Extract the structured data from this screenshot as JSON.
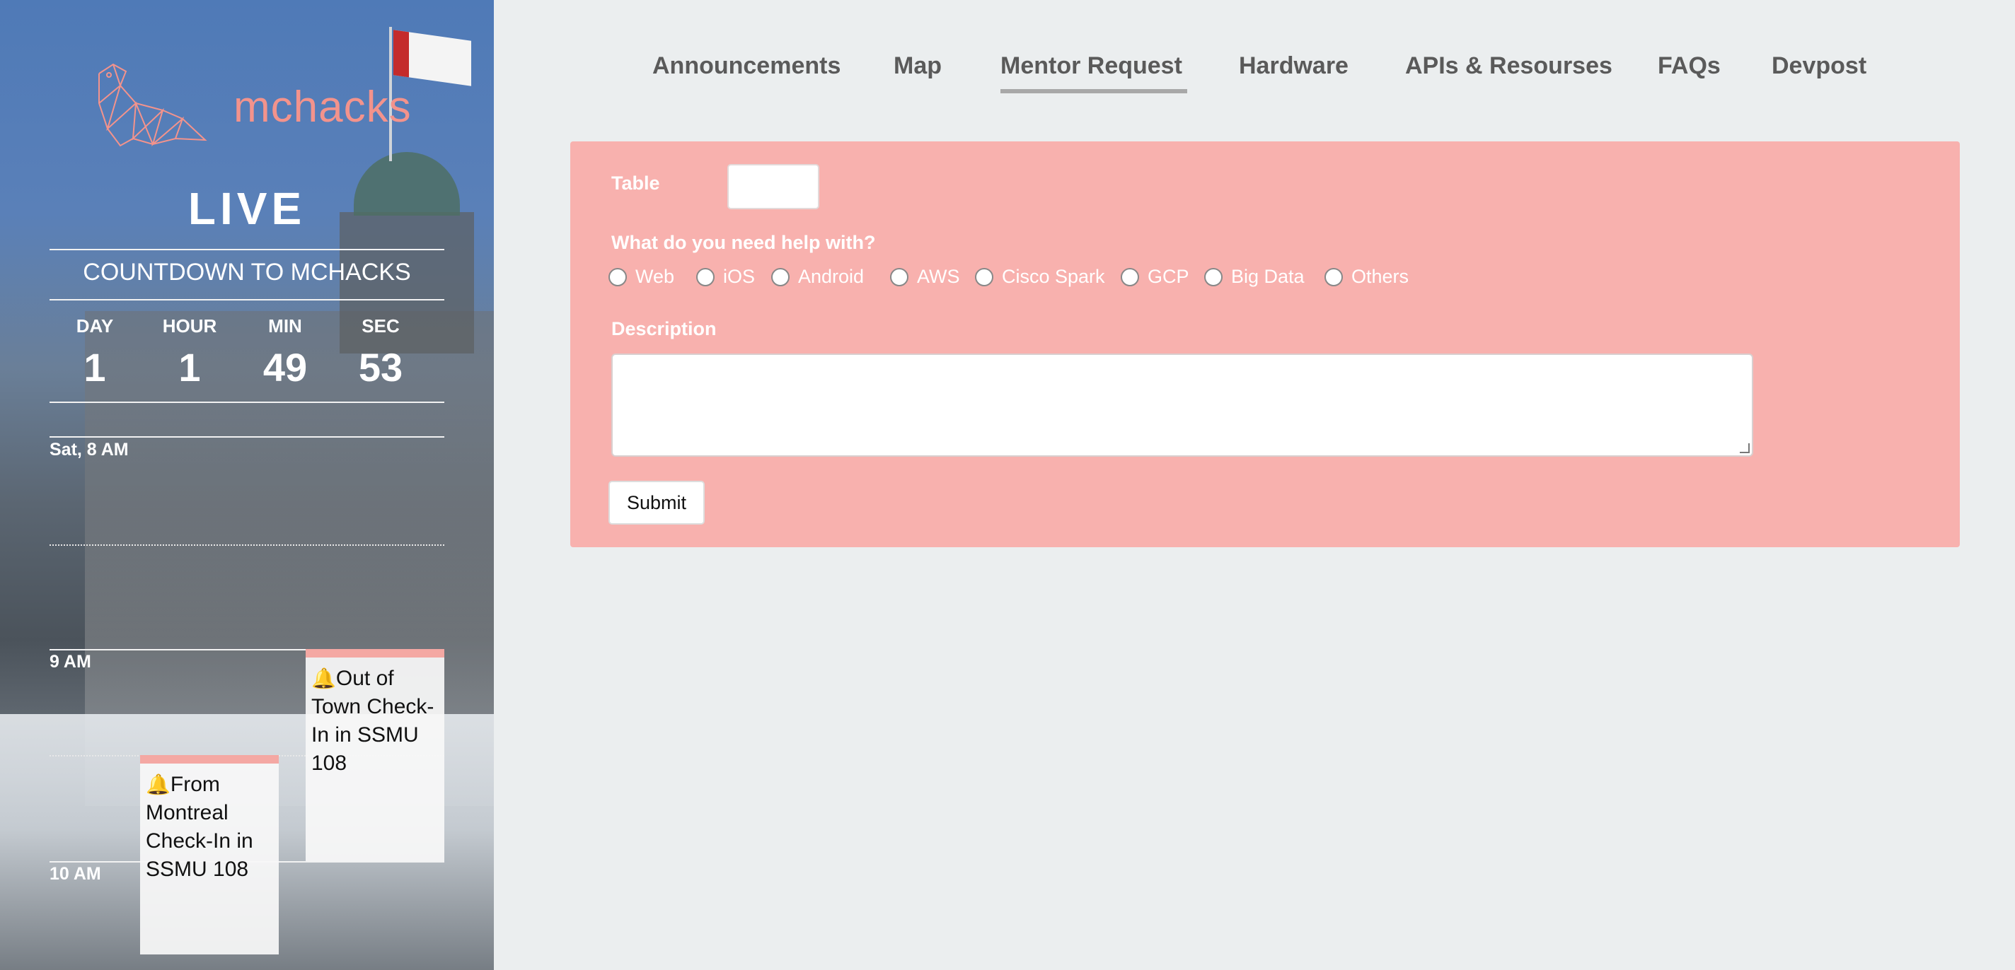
{
  "sidebar": {
    "logo_text": "mchacks",
    "live": "LIVE",
    "countdown_title": "COUNTDOWN TO MCHACKS",
    "countdown": [
      {
        "label": "DAY",
        "value": "1"
      },
      {
        "label": "HOUR",
        "value": "1"
      },
      {
        "label": "MIN",
        "value": "49"
      },
      {
        "label": "SEC",
        "value": "53"
      }
    ],
    "time_labels": [
      "Sat, 8 AM",
      "9 AM",
      "10 AM"
    ],
    "events": [
      {
        "title": "Out of Town Check-In in SSMU 108"
      },
      {
        "title": "From Montreal Check-In in SSMU 108"
      }
    ]
  },
  "nav": {
    "items": [
      "Announcements",
      "Map",
      "Mentor Request",
      "Hardware",
      "APIs & Resourses",
      "FAQs",
      "Devpost"
    ],
    "active": "Mentor Request"
  },
  "form": {
    "table_label": "Table",
    "table_value": "",
    "help_label": "What do you need help with?",
    "options": [
      "Web",
      "iOS",
      "Android",
      "AWS",
      "Cisco Spark",
      "GCP",
      "Big Data",
      "Others"
    ],
    "description_label": "Description",
    "description_value": "",
    "submit_label": "Submit"
  },
  "colors": {
    "accent_pink": "#f8b1ae",
    "logo_pink": "#f3938c",
    "bell_red": "#e24b3f",
    "page_bg": "#ebeeef"
  }
}
